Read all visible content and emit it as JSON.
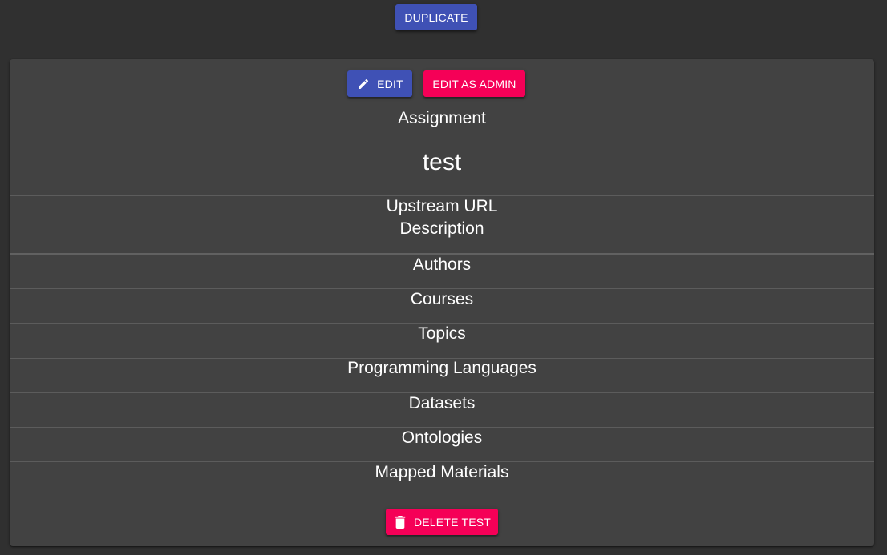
{
  "toolbar": {
    "duplicate_label": "Duplicate"
  },
  "card": {
    "edit_label": "Edit",
    "edit_admin_label": "Edit as admin",
    "type_label": "Assignment",
    "name": "test",
    "sections": {
      "upstream_url": "Upstream URL",
      "description": "Description",
      "authors": "Authors",
      "courses": "Courses",
      "topics": "Topics",
      "programming_languages": "Programming Languages",
      "datasets": "Datasets",
      "ontologies": "Ontologies",
      "mapped_materials": "Mapped Materials"
    },
    "delete_label": "Delete test"
  },
  "icons": {
    "edit": "pencil-icon",
    "delete": "trash-icon"
  },
  "colors": {
    "background": "#303030",
    "card": "#424242",
    "primary": "#3f51b5",
    "accent": "#f50057"
  }
}
